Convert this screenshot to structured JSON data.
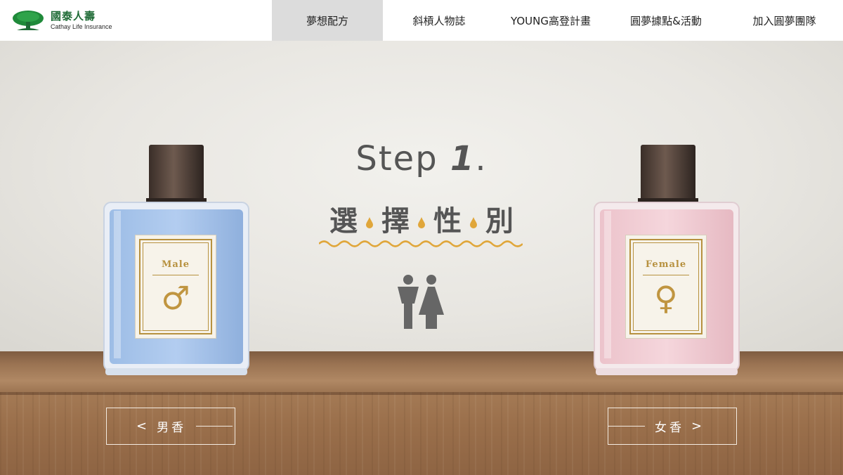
{
  "header": {
    "logo_cn": "國泰人壽",
    "logo_en": "Cathay Life Insurance",
    "nav": [
      {
        "label": "夢想配方",
        "active": true
      },
      {
        "label": "斜槓人物誌",
        "active": false
      },
      {
        "label": "YOUNG高登計畫",
        "active": false
      },
      {
        "label": "圓夢據點&活動",
        "active": false
      },
      {
        "label": "加入圓夢團隊",
        "active": false
      }
    ]
  },
  "hero": {
    "step_prefix": "Step ",
    "step_number": "1",
    "step_suffix": ".",
    "subtitle_chars": [
      "選",
      "擇",
      "性",
      "別"
    ]
  },
  "bottles": {
    "male": {
      "label": "Male",
      "symbol": "♂",
      "color": "#a9c6ea"
    },
    "female": {
      "label": "Female",
      "symbol": "♀",
      "color": "#f1cdd4"
    }
  },
  "buttons": {
    "male": {
      "label": "男香",
      "arrow": "<"
    },
    "female": {
      "label": "女香",
      "arrow": ">"
    }
  },
  "colors": {
    "accent_gold": "#e0a63a",
    "brand_green": "#1f6b36",
    "text_gray": "#555555"
  }
}
